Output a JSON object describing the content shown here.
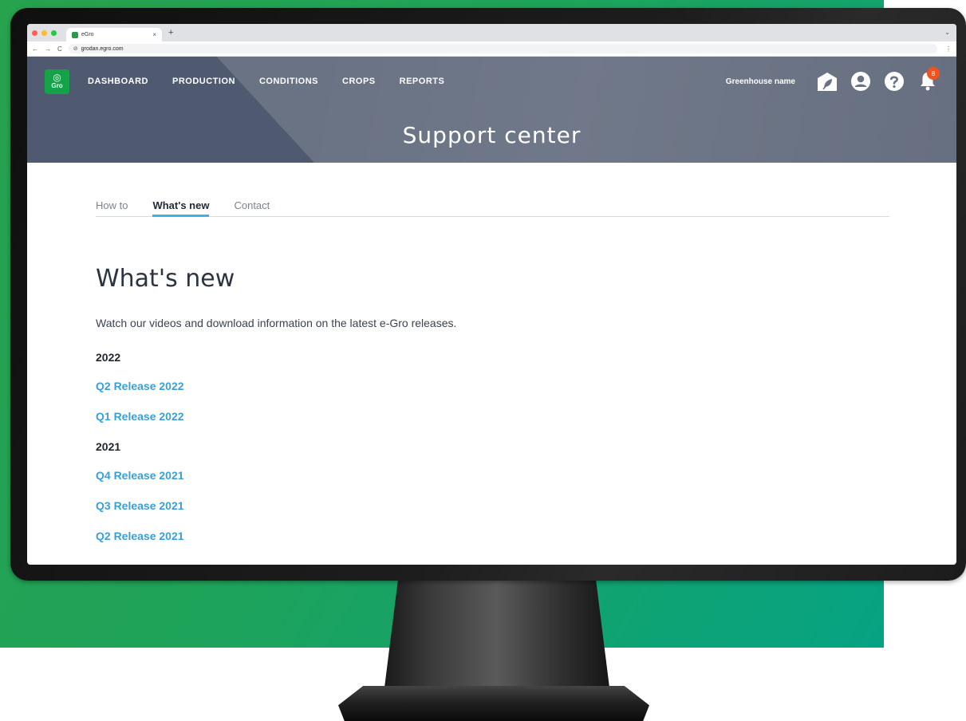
{
  "browser": {
    "tab_title": "eGro",
    "tab_close": "×",
    "new_tab": "+",
    "back": "←",
    "forward": "→",
    "reload": "C",
    "url": "grodan.egro.com",
    "expand": "⌄",
    "more": "⋮",
    "traffic_colors": [
      "#ff5f57",
      "#febc2e",
      "#28c840"
    ]
  },
  "app": {
    "logo_mark": "◎",
    "logo_text": "Gro",
    "nav": [
      {
        "label": "DASHBOARD"
      },
      {
        "label": "PRODUCTION"
      },
      {
        "label": "CONDITIONS"
      },
      {
        "label": "CROPS"
      },
      {
        "label": "REPORTS"
      }
    ],
    "greenhouse_name": "Greenhouse name",
    "notification_count": "8",
    "page_title": "Support center"
  },
  "support": {
    "tabs": [
      {
        "label": "How to",
        "active": false
      },
      {
        "label": "What's new",
        "active": true
      },
      {
        "label": "Contact",
        "active": false
      }
    ],
    "title": "What's new",
    "intro": "Watch our videos and download information on the latest e-Gro releases.",
    "groups": [
      {
        "year": "2022",
        "releases": [
          "Q2 Release 2022",
          "Q1 Release 2022"
        ]
      },
      {
        "year": "2021",
        "releases": [
          "Q4 Release 2021",
          "Q3 Release 2021",
          "Q2 Release 2021"
        ]
      }
    ]
  },
  "colors": {
    "header_bg": "#6a7384",
    "accent_link": "#3a9fd6",
    "tab_underline": "#39b3e0",
    "logo_green": "#16a248",
    "notification": "#f4511e"
  }
}
